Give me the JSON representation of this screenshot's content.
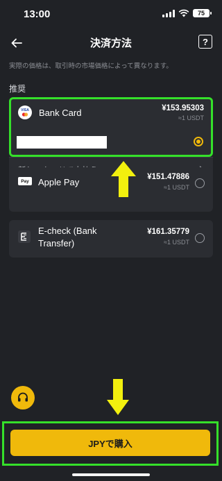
{
  "status_bar": {
    "time": "13:00",
    "battery": "75"
  },
  "header": {
    "title": "決済方法",
    "help_label": "?"
  },
  "notice": "実際の価格は、取引時の市場価格によって異なります。",
  "section_label": "推奨",
  "methods": [
    {
      "name": "Bank Card",
      "price": "¥153.95303",
      "rate": "≈1 USDT",
      "selected": true,
      "icon": "visa-mastercard-icon"
    },
    {
      "name": "Apple Pay",
      "price": "¥151.47886",
      "rate": "≈1 USDT",
      "selected": false,
      "icon": "apple-pay-icon"
    },
    {
      "name_line1": "E-check (Bank",
      "name_line2": "Transfer)",
      "price": "¥161.35779",
      "rate": "≈1 USDT",
      "selected": false,
      "icon": "echeck-icon"
    }
  ],
  "new_card_label": "新しいカードで支払う",
  "apple_pay_badge": "Pay",
  "visa_text": "VISA",
  "buy_button": "JPYで購入",
  "colors": {
    "accent": "#f0b90b",
    "highlight": "#35e02a",
    "annotation_arrow": "#f2f00e",
    "background": "#202226",
    "card": "#2b2d32"
  }
}
